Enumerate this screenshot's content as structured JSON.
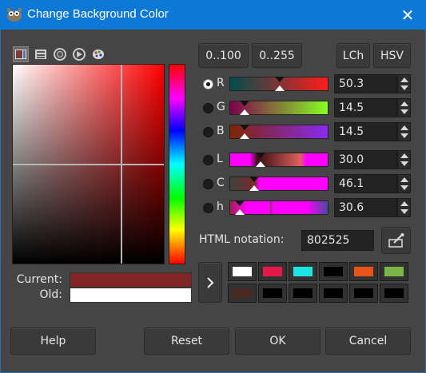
{
  "window": {
    "title": "Change Background Color",
    "close_glyph": "✕"
  },
  "selectors": [
    "gimp-selector-icon",
    "scales-selector-icon",
    "wheel-selector-icon",
    "triangle-selector-icon",
    "watercolor-selector-icon"
  ],
  "range_buttons": {
    "range_100": "0..100",
    "range_255": "0..255"
  },
  "model_buttons": {
    "lch": "LCh",
    "hsv": "HSV"
  },
  "channels": [
    {
      "key": "R",
      "label": "R",
      "value": "50.3",
      "checked": true
    },
    {
      "key": "G",
      "label": "G",
      "value": "14.5",
      "checked": false
    },
    {
      "key": "B",
      "label": "B",
      "value": "14.5",
      "checked": false
    },
    {
      "key": "L",
      "label": "L",
      "value": "30.0",
      "checked": false
    },
    {
      "key": "C",
      "label": "C",
      "value": "46.1",
      "checked": false
    },
    {
      "key": "h",
      "label": "h",
      "value": "30.6",
      "checked": false
    }
  ],
  "swatches": {
    "current_label": "Current:",
    "old_label": "Old:",
    "current_color": "#802525",
    "old_color": "#ffffff"
  },
  "html_notation": {
    "label": "HTML notation:",
    "value": "802525"
  },
  "history_colors": [
    "#ffffff",
    "#e8174a",
    "#1de3e3",
    "#000000",
    "#e85418",
    "#7ab547",
    "#4a2a20",
    "#000000",
    "#000000",
    "#000000",
    "#000000",
    "#000000"
  ],
  "footer": {
    "help": "Help",
    "reset": "Reset",
    "ok": "OK",
    "cancel": "Cancel"
  },
  "colors": {
    "accent": "#0e78d6",
    "background": "#454545"
  }
}
